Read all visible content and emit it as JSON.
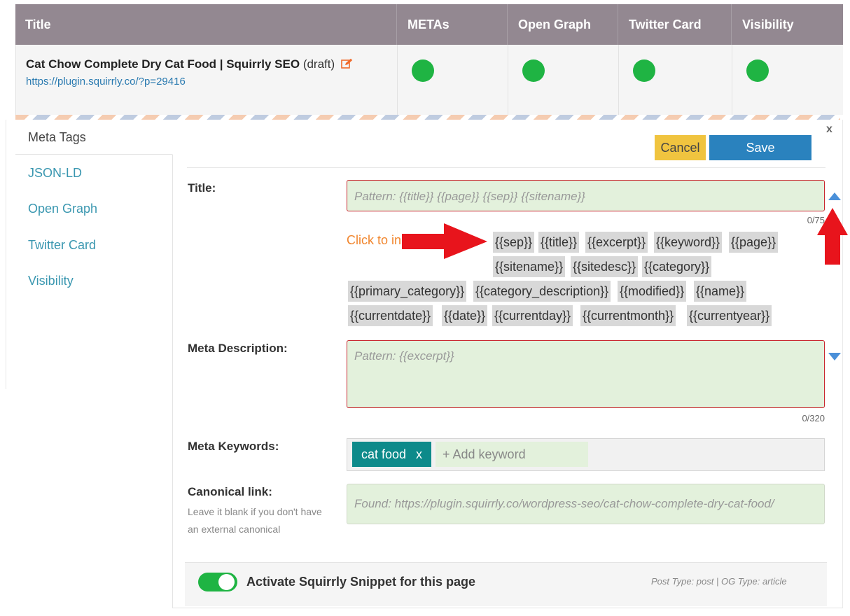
{
  "table": {
    "headers": [
      "Title",
      "METAs",
      "Open Graph",
      "Twitter Card",
      "Visibility"
    ],
    "row": {
      "title": "Cat Chow Complete Dry Cat Food | Squirrly SEO",
      "status": "(draft)",
      "url": "https://plugin.squirrly.co/?p=29416",
      "status_colors": {
        "metas": "#1fb443",
        "open_graph": "#1fb443",
        "twitter_card": "#1fb443",
        "visibility": "#1fb443"
      }
    }
  },
  "sidebar": {
    "items": [
      {
        "label": "Meta Tags",
        "active": true
      },
      {
        "label": "JSON-LD"
      },
      {
        "label": "Open Graph"
      },
      {
        "label": "Twitter Card"
      },
      {
        "label": "Visibility"
      }
    ]
  },
  "panel": {
    "close": "x",
    "cancel_label": "Cancel",
    "save_label": "Save"
  },
  "title_field": {
    "label": "Title:",
    "placeholder": "Pattern: {{title}} {{page}} {{sep}} {{sitename}}",
    "counter": "0/75",
    "click_hint": "Click to in",
    "variables": [
      "{{sep}}",
      "{{title}}",
      "{{excerpt}}",
      "{{keyword}}",
      "{{page}}",
      "{{sitename}}",
      "{{sitedesc}}",
      "{{category}}",
      "{{primary_category}}",
      "{{category_description}}",
      "{{modified}}",
      "{{name}}",
      "{{currentdate}}",
      "{{date}}",
      "{{currentday}}",
      "{{currentmonth}}",
      "{{currentyear}}"
    ]
  },
  "description_field": {
    "label": "Meta Description:",
    "placeholder": "Pattern: {{excerpt}}",
    "counter": "0/320"
  },
  "keywords_field": {
    "label": "Meta Keywords:",
    "tags": [
      {
        "text": "cat food",
        "remove": "x"
      }
    ],
    "add_placeholder": "+ Add keyword"
  },
  "canonical_field": {
    "label": "Canonical link:",
    "help": "Leave it blank if you don't have an external canonical",
    "placeholder": "Found: https://plugin.squirrly.co/wordpress-seo/cat-chow-complete-dry-cat-food/"
  },
  "footer": {
    "toggle_on": true,
    "label": "Activate Squirrly Snippet for this page",
    "meta": "Post Type: post | OG Type: article"
  },
  "colors": {
    "header_bg": "#938891",
    "accent_link": "#3a97b0",
    "save_button": "#2a82be",
    "cancel_button": "#f0c43f",
    "field_bg": "#e3f1dc",
    "field_error_border": "#c8262e",
    "annotation_arrow": "#e8141c"
  }
}
